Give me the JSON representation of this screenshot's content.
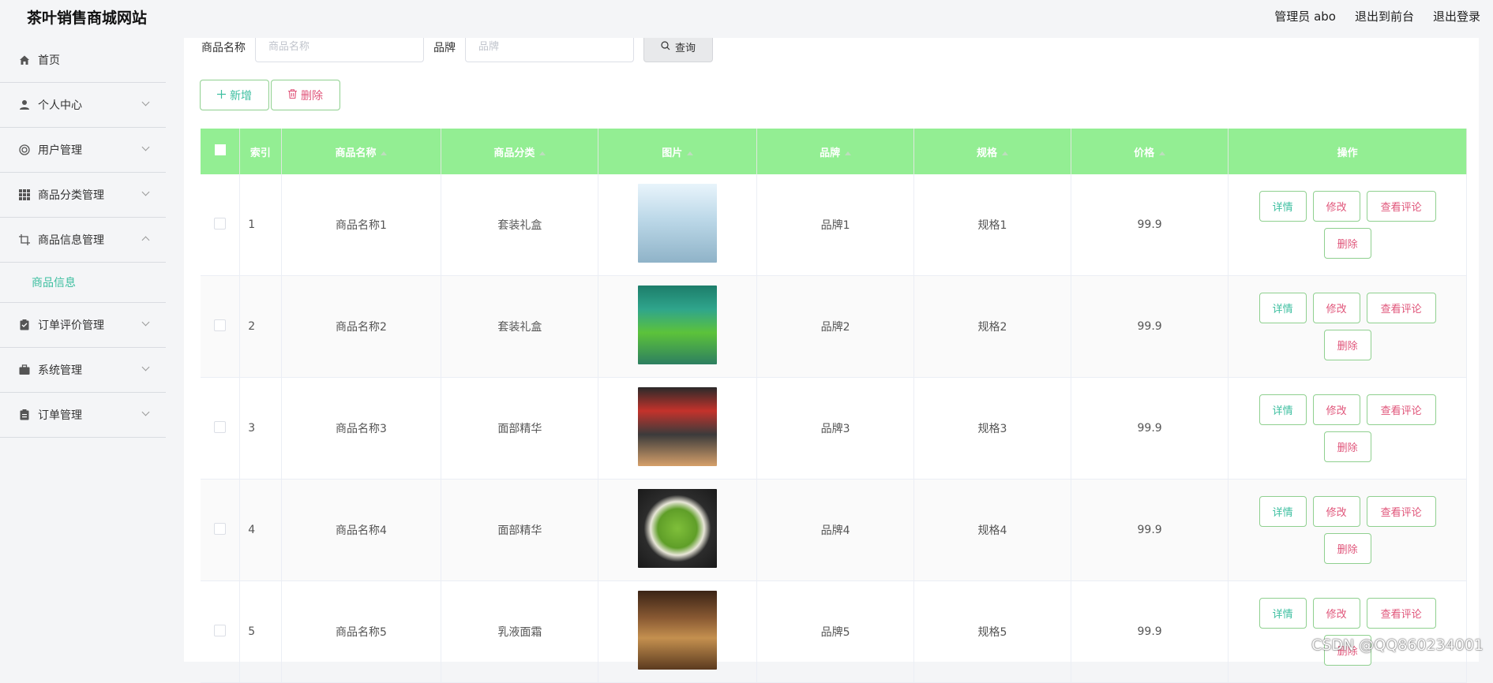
{
  "site": {
    "title": "茶叶销售商城网站"
  },
  "topbar": {
    "user": "管理员 abo",
    "to_front": "退出到前台",
    "logout": "退出登录"
  },
  "sidebar": {
    "items": [
      {
        "label": "首页",
        "icon": "home-icon"
      },
      {
        "label": "个人中心",
        "icon": "user-icon"
      },
      {
        "label": "用户管理",
        "icon": "users-icon"
      },
      {
        "label": "商品分类管理",
        "icon": "grid-icon"
      },
      {
        "label": "商品信息管理",
        "icon": "crop-icon"
      },
      {
        "label": "订单评价管理",
        "icon": "clipboard-icon"
      },
      {
        "label": "系统管理",
        "icon": "briefcase-icon"
      },
      {
        "label": "订单管理",
        "icon": "clipboard-icon"
      }
    ],
    "submenu_active": "商品信息"
  },
  "search": {
    "name_label": "商品名称",
    "name_placeholder": "商品名称",
    "brand_label": "品牌",
    "brand_placeholder": "品牌",
    "query_button": "查询"
  },
  "actions": {
    "add": "新增",
    "delete": "删除"
  },
  "table": {
    "headers": [
      "索引",
      "商品名称",
      "商品分类",
      "图片",
      "品牌",
      "规格",
      "价格",
      "操作"
    ],
    "rows": [
      {
        "index": "1",
        "name": "商品名称1",
        "category": "套装礼盒",
        "brand": "品牌1",
        "spec": "规格1",
        "price": "99.9"
      },
      {
        "index": "2",
        "name": "商品名称2",
        "category": "套装礼盒",
        "brand": "品牌2",
        "spec": "规格2",
        "price": "99.9"
      },
      {
        "index": "3",
        "name": "商品名称3",
        "category": "面部精华",
        "brand": "品牌3",
        "spec": "规格3",
        "price": "99.9"
      },
      {
        "index": "4",
        "name": "商品名称4",
        "category": "面部精华",
        "brand": "品牌4",
        "spec": "规格4",
        "price": "99.9"
      },
      {
        "index": "5",
        "name": "商品名称5",
        "category": "乳液面霜",
        "brand": "品牌5",
        "spec": "规格5",
        "price": "99.9"
      }
    ],
    "op": {
      "detail": "详情",
      "edit": "修改",
      "review": "查看评论",
      "delete": "删除"
    }
  },
  "watermark": "CSDN @QQ860234001",
  "colors": {
    "header_green": "#93ee93",
    "accent_teal": "#3dbfa0",
    "danger_pink": "#e0557a"
  }
}
